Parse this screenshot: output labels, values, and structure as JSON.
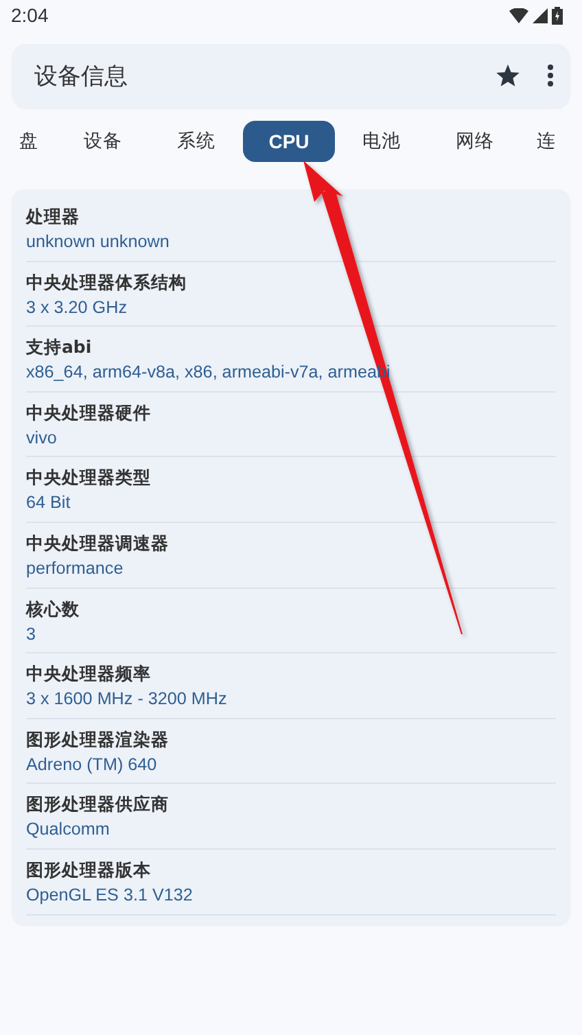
{
  "status_bar": {
    "time": "2:04"
  },
  "app_bar": {
    "title": "设备信息"
  },
  "tabs": [
    {
      "label": "盘",
      "selected": false
    },
    {
      "label": "设备",
      "selected": false
    },
    {
      "label": "系统",
      "selected": false
    },
    {
      "label": "CPU",
      "selected": true
    },
    {
      "label": "电池",
      "selected": false
    },
    {
      "label": "网络",
      "selected": false
    },
    {
      "label": "连",
      "selected": false
    }
  ],
  "info_rows": [
    {
      "label": "处理器",
      "value": "unknown unknown"
    },
    {
      "label": "中央处理器体系结构",
      "value": "3 x 3.20 GHz"
    },
    {
      "label": "支持abi",
      "value": "x86_64, arm64-v8a, x86, armeabi-v7a, armeabi"
    },
    {
      "label": "中央处理器硬件",
      "value": "vivo"
    },
    {
      "label": "中央处理器类型",
      "value": "64 Bit"
    },
    {
      "label": "中央处理器调速器",
      "value": "performance"
    },
    {
      "label": "核心数",
      "value": "3"
    },
    {
      "label": "中央处理器频率",
      "value": "3 x 1600 MHz - 3200 MHz"
    },
    {
      "label": "图形处理器渲染器",
      "value": "Adreno (TM) 640"
    },
    {
      "label": "图形处理器供应商",
      "value": "Qualcomm"
    },
    {
      "label": "图形处理器版本",
      "value": "OpenGL ES 3.1 V132"
    }
  ],
  "annotation": {
    "kind": "arrow"
  }
}
